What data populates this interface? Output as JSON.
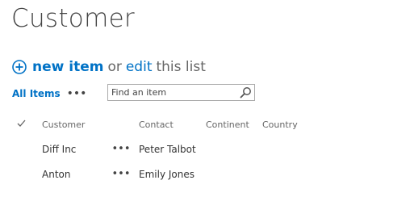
{
  "page": {
    "title": "Customer"
  },
  "actions": {
    "new_item_label": "new item",
    "or_text": "or",
    "edit_label": "edit",
    "this_list_text": "this list"
  },
  "views": {
    "current_view": "All Items",
    "more_label": "•••"
  },
  "search": {
    "placeholder": "Find an item"
  },
  "list": {
    "columns": [
      "Customer",
      "Contact",
      "Continent",
      "Country"
    ],
    "rows": [
      {
        "customer": "Diff Inc",
        "contact": "Peter Talbot",
        "continent": "",
        "country": ""
      },
      {
        "customer": "Anton",
        "contact": "Emily Jones",
        "continent": "",
        "country": ""
      }
    ],
    "row_menu_label": "•••"
  },
  "icons": {
    "add": "plus-circle-icon",
    "search": "magnifier-icon",
    "select_all": "checkmark-icon"
  },
  "colors": {
    "accent": "#0072c6",
    "title_text": "#444444",
    "muted_text": "#666666"
  }
}
